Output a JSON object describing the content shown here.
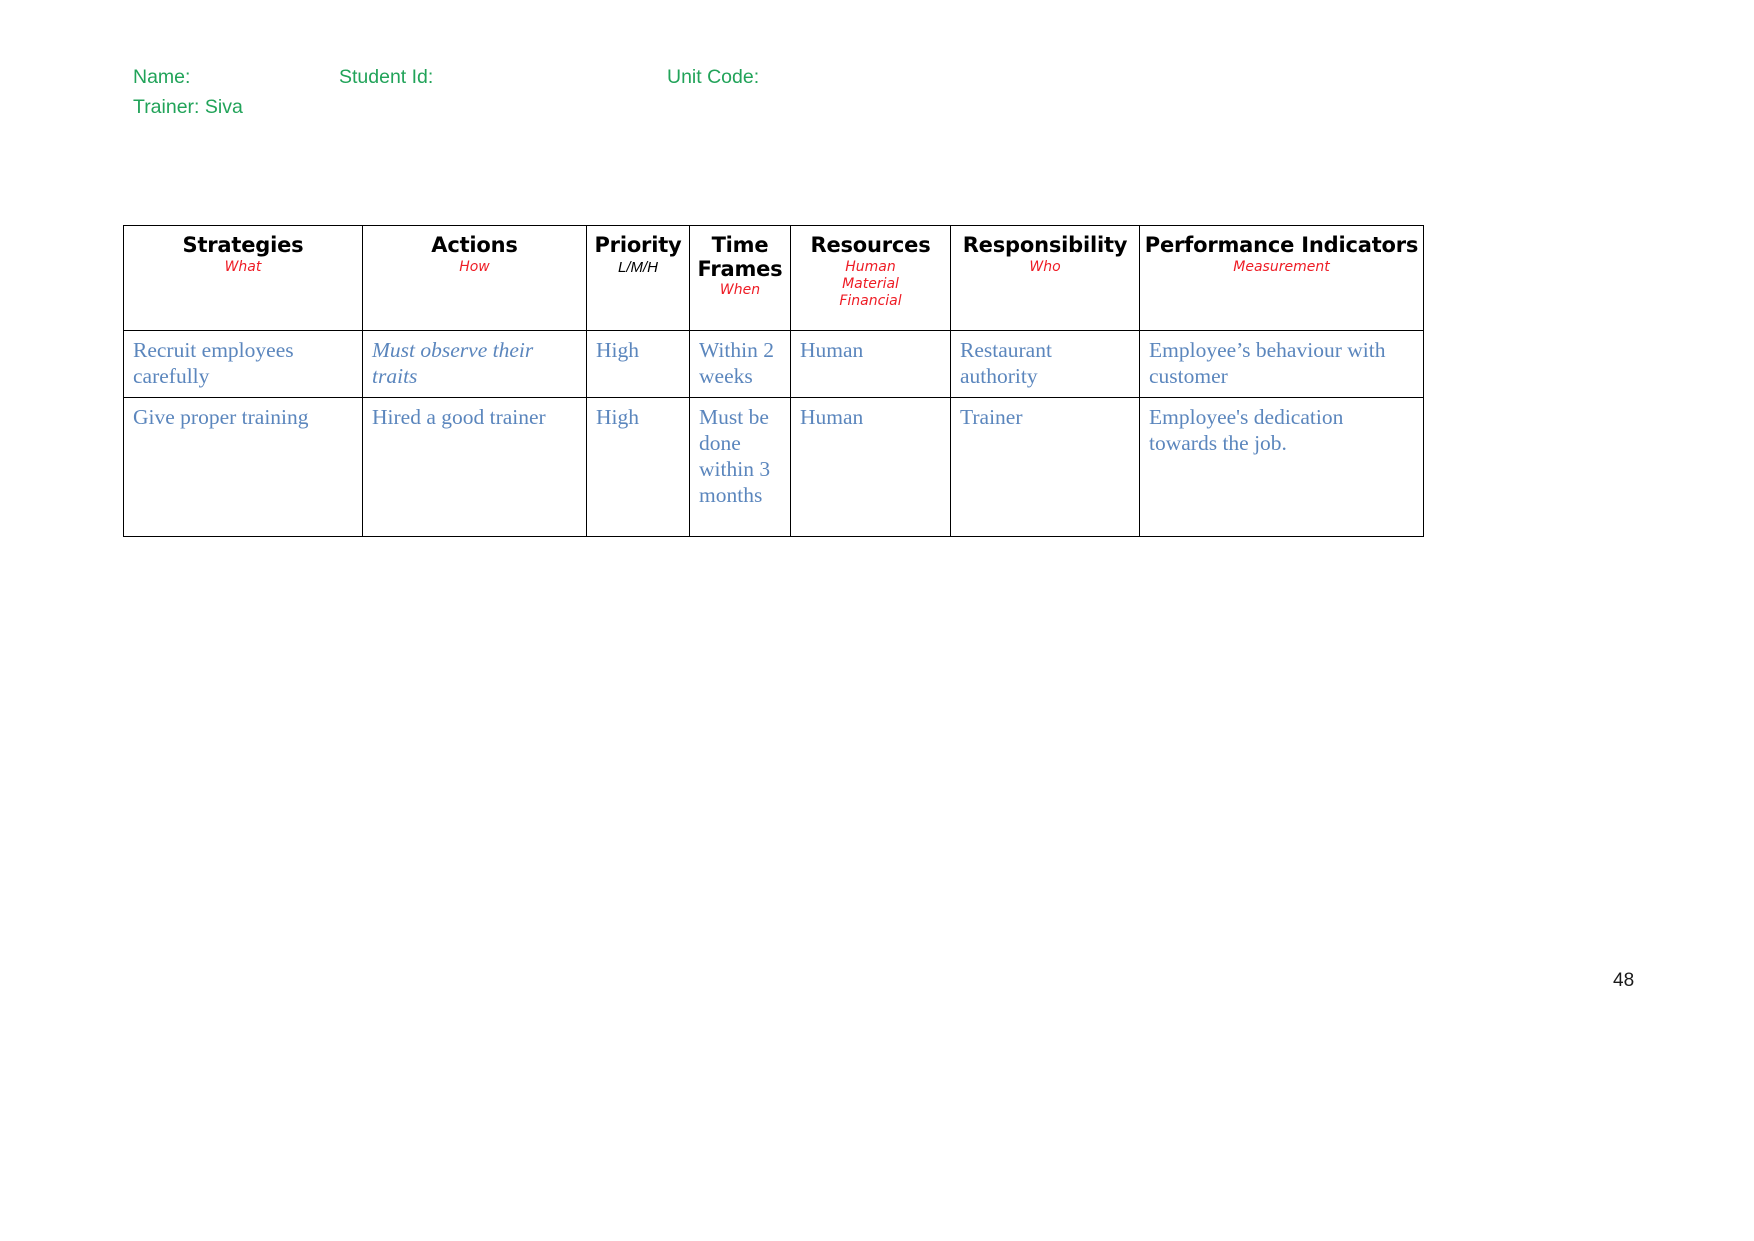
{
  "document": {
    "header": {
      "name_label": "Name:",
      "student_id_label": "Student Id:",
      "unit_code_label": "Unit Code:",
      "trainer_label": "Trainer: Siva"
    },
    "page_number": "48",
    "colors": {
      "header_green": "#21a359",
      "table_subheading_red": "#ee1c25",
      "table_body_blue": "#5b86bd",
      "table_border_black": "#000000"
    }
  },
  "table": {
    "columns": [
      {
        "title": "Strategies",
        "subtitle": [
          "What"
        ],
        "subtitle_color": "red"
      },
      {
        "title": "Actions",
        "subtitle": [
          "How"
        ],
        "subtitle_color": "red"
      },
      {
        "title": "Priority",
        "subtitle": [
          "L/M/H"
        ],
        "subtitle_color": "black"
      },
      {
        "title": "Time Frames",
        "subtitle": [
          "When"
        ],
        "subtitle_color": "red"
      },
      {
        "title": "Resources",
        "subtitle": [
          "Human",
          "Material",
          "Financial"
        ],
        "subtitle_color": "red"
      },
      {
        "title": "Responsibility",
        "subtitle": [
          "Who"
        ],
        "subtitle_color": "red"
      },
      {
        "title": "Performance Indicators",
        "subtitle": [
          "Measurement"
        ],
        "subtitle_color": "red"
      }
    ],
    "rows": [
      {
        "strategies": "Recruit employees carefully",
        "actions": "Must observe their traits",
        "actions_italic": true,
        "priority": "High",
        "time_frames": "Within 2 weeks",
        "resources": "Human",
        "responsibility": "Restaurant authority",
        "performance_indicators": "Employee’s behaviour with customer"
      },
      {
        "strategies": "Give proper training",
        "actions": "Hired a good trainer",
        "actions_italic": false,
        "priority": "High",
        "time_frames": "Must be done within 3 months",
        "resources": "Human",
        "responsibility": "Trainer",
        "performance_indicators": "Employee's dedication towards the job."
      }
    ]
  }
}
